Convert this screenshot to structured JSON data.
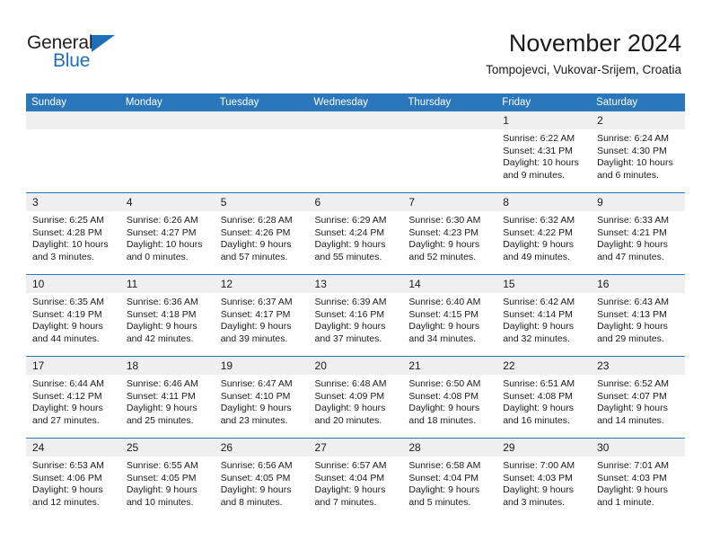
{
  "logo": {
    "general": "General",
    "blue": "Blue",
    "triangle_color": "#1d70b7"
  },
  "header": {
    "title": "November 2024",
    "subtitle": "Tompojevci, Vukovar-Srijem, Croatia"
  },
  "theme": {
    "header_bg": "#2b77bc",
    "daynum_bg": "#efefef",
    "text": "#1a1a1a"
  },
  "weekday_headers": [
    "Sunday",
    "Monday",
    "Tuesday",
    "Wednesday",
    "Thursday",
    "Friday",
    "Saturday"
  ],
  "weeks": [
    [
      {
        "day": "",
        "blank": true
      },
      {
        "day": "",
        "blank": true
      },
      {
        "day": "",
        "blank": true
      },
      {
        "day": "",
        "blank": true
      },
      {
        "day": "",
        "blank": true
      },
      {
        "day": "1",
        "sunrise": "Sunrise: 6:22 AM",
        "sunset": "Sunset: 4:31 PM",
        "daylight": "Daylight: 10 hours and 9 minutes."
      },
      {
        "day": "2",
        "sunrise": "Sunrise: 6:24 AM",
        "sunset": "Sunset: 4:30 PM",
        "daylight": "Daylight: 10 hours and 6 minutes."
      }
    ],
    [
      {
        "day": "3",
        "sunrise": "Sunrise: 6:25 AM",
        "sunset": "Sunset: 4:28 PM",
        "daylight": "Daylight: 10 hours and 3 minutes."
      },
      {
        "day": "4",
        "sunrise": "Sunrise: 6:26 AM",
        "sunset": "Sunset: 4:27 PM",
        "daylight": "Daylight: 10 hours and 0 minutes."
      },
      {
        "day": "5",
        "sunrise": "Sunrise: 6:28 AM",
        "sunset": "Sunset: 4:26 PM",
        "daylight": "Daylight: 9 hours and 57 minutes."
      },
      {
        "day": "6",
        "sunrise": "Sunrise: 6:29 AM",
        "sunset": "Sunset: 4:24 PM",
        "daylight": "Daylight: 9 hours and 55 minutes."
      },
      {
        "day": "7",
        "sunrise": "Sunrise: 6:30 AM",
        "sunset": "Sunset: 4:23 PM",
        "daylight": "Daylight: 9 hours and 52 minutes."
      },
      {
        "day": "8",
        "sunrise": "Sunrise: 6:32 AM",
        "sunset": "Sunset: 4:22 PM",
        "daylight": "Daylight: 9 hours and 49 minutes."
      },
      {
        "day": "9",
        "sunrise": "Sunrise: 6:33 AM",
        "sunset": "Sunset: 4:21 PM",
        "daylight": "Daylight: 9 hours and 47 minutes."
      }
    ],
    [
      {
        "day": "10",
        "sunrise": "Sunrise: 6:35 AM",
        "sunset": "Sunset: 4:19 PM",
        "daylight": "Daylight: 9 hours and 44 minutes."
      },
      {
        "day": "11",
        "sunrise": "Sunrise: 6:36 AM",
        "sunset": "Sunset: 4:18 PM",
        "daylight": "Daylight: 9 hours and 42 minutes."
      },
      {
        "day": "12",
        "sunrise": "Sunrise: 6:37 AM",
        "sunset": "Sunset: 4:17 PM",
        "daylight": "Daylight: 9 hours and 39 minutes."
      },
      {
        "day": "13",
        "sunrise": "Sunrise: 6:39 AM",
        "sunset": "Sunset: 4:16 PM",
        "daylight": "Daylight: 9 hours and 37 minutes."
      },
      {
        "day": "14",
        "sunrise": "Sunrise: 6:40 AM",
        "sunset": "Sunset: 4:15 PM",
        "daylight": "Daylight: 9 hours and 34 minutes."
      },
      {
        "day": "15",
        "sunrise": "Sunrise: 6:42 AM",
        "sunset": "Sunset: 4:14 PM",
        "daylight": "Daylight: 9 hours and 32 minutes."
      },
      {
        "day": "16",
        "sunrise": "Sunrise: 6:43 AM",
        "sunset": "Sunset: 4:13 PM",
        "daylight": "Daylight: 9 hours and 29 minutes."
      }
    ],
    [
      {
        "day": "17",
        "sunrise": "Sunrise: 6:44 AM",
        "sunset": "Sunset: 4:12 PM",
        "daylight": "Daylight: 9 hours and 27 minutes."
      },
      {
        "day": "18",
        "sunrise": "Sunrise: 6:46 AM",
        "sunset": "Sunset: 4:11 PM",
        "daylight": "Daylight: 9 hours and 25 minutes."
      },
      {
        "day": "19",
        "sunrise": "Sunrise: 6:47 AM",
        "sunset": "Sunset: 4:10 PM",
        "daylight": "Daylight: 9 hours and 23 minutes."
      },
      {
        "day": "20",
        "sunrise": "Sunrise: 6:48 AM",
        "sunset": "Sunset: 4:09 PM",
        "daylight": "Daylight: 9 hours and 20 minutes."
      },
      {
        "day": "21",
        "sunrise": "Sunrise: 6:50 AM",
        "sunset": "Sunset: 4:08 PM",
        "daylight": "Daylight: 9 hours and 18 minutes."
      },
      {
        "day": "22",
        "sunrise": "Sunrise: 6:51 AM",
        "sunset": "Sunset: 4:08 PM",
        "daylight": "Daylight: 9 hours and 16 minutes."
      },
      {
        "day": "23",
        "sunrise": "Sunrise: 6:52 AM",
        "sunset": "Sunset: 4:07 PM",
        "daylight": "Daylight: 9 hours and 14 minutes."
      }
    ],
    [
      {
        "day": "24",
        "sunrise": "Sunrise: 6:53 AM",
        "sunset": "Sunset: 4:06 PM",
        "daylight": "Daylight: 9 hours and 12 minutes."
      },
      {
        "day": "25",
        "sunrise": "Sunrise: 6:55 AM",
        "sunset": "Sunset: 4:05 PM",
        "daylight": "Daylight: 9 hours and 10 minutes."
      },
      {
        "day": "26",
        "sunrise": "Sunrise: 6:56 AM",
        "sunset": "Sunset: 4:05 PM",
        "daylight": "Daylight: 9 hours and 8 minutes."
      },
      {
        "day": "27",
        "sunrise": "Sunrise: 6:57 AM",
        "sunset": "Sunset: 4:04 PM",
        "daylight": "Daylight: 9 hours and 7 minutes."
      },
      {
        "day": "28",
        "sunrise": "Sunrise: 6:58 AM",
        "sunset": "Sunset: 4:04 PM",
        "daylight": "Daylight: 9 hours and 5 minutes."
      },
      {
        "day": "29",
        "sunrise": "Sunrise: 7:00 AM",
        "sunset": "Sunset: 4:03 PM",
        "daylight": "Daylight: 9 hours and 3 minutes."
      },
      {
        "day": "30",
        "sunrise": "Sunrise: 7:01 AM",
        "sunset": "Sunset: 4:03 PM",
        "daylight": "Daylight: 9 hours and 1 minute."
      }
    ]
  ]
}
